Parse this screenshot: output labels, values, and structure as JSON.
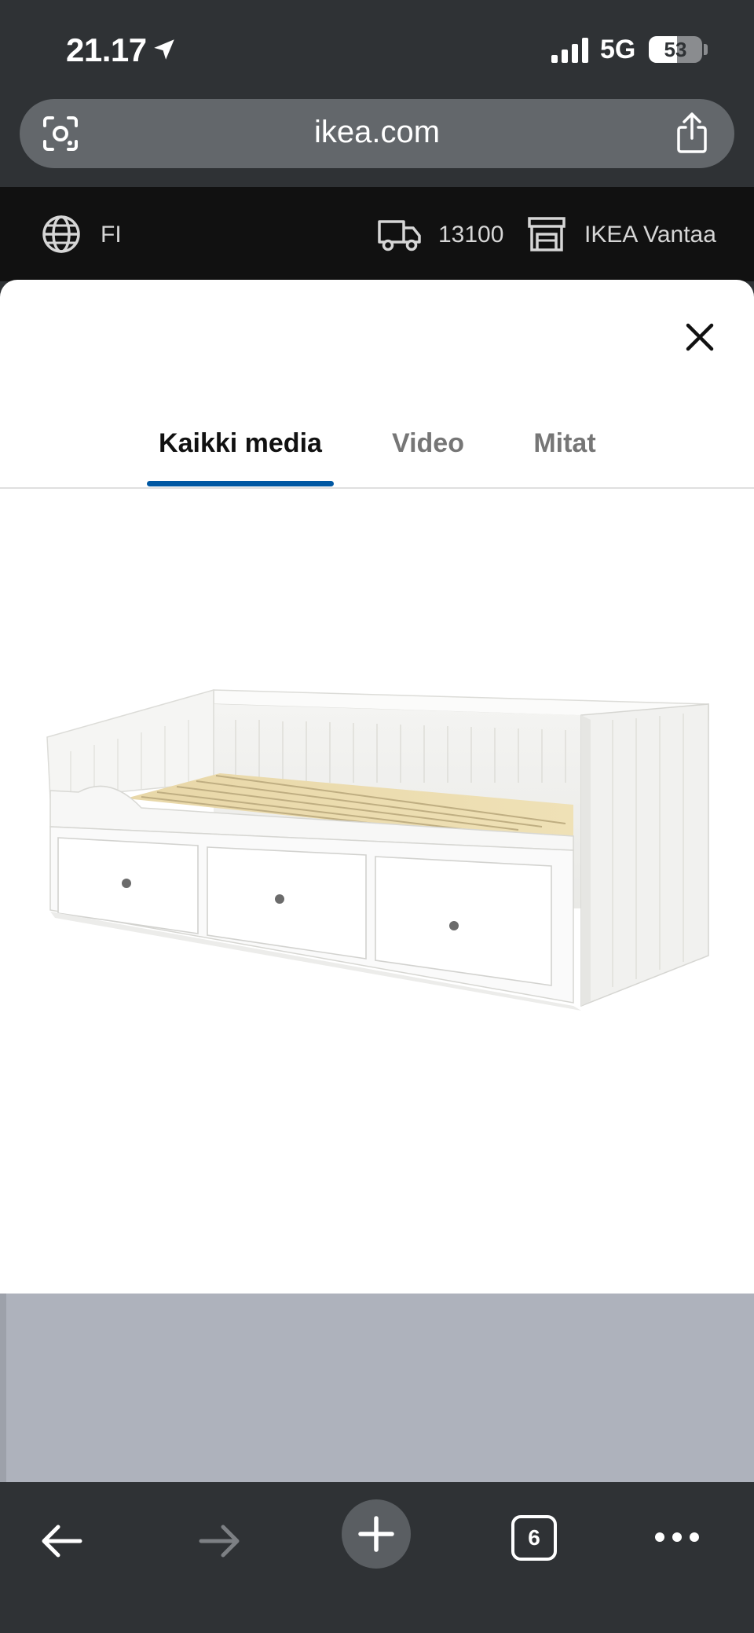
{
  "status": {
    "time": "21.17",
    "network": "5G",
    "battery": "53",
    "battery_level": 0.53
  },
  "browser": {
    "url": "ikea.com"
  },
  "ikea_bar": {
    "language": "FI",
    "postal_code": "13100",
    "store": "IKEA Vantaa"
  },
  "tabs": [
    {
      "label": "Kaikki media",
      "active": true
    },
    {
      "label": "Video",
      "active": false
    },
    {
      "label": "Mitat",
      "active": false
    }
  ],
  "toolbar": {
    "tab_count": "6"
  },
  "colors": {
    "accent": "#0058a3",
    "chrome": "#2f3235",
    "strip": "#111111"
  },
  "icons": [
    "location-arrow-icon",
    "signal-icon",
    "lens-icon",
    "share-icon",
    "globe-icon",
    "truck-icon",
    "store-icon",
    "close-icon",
    "back-icon",
    "forward-icon",
    "plus-icon",
    "tabs-icon",
    "more-icon"
  ]
}
